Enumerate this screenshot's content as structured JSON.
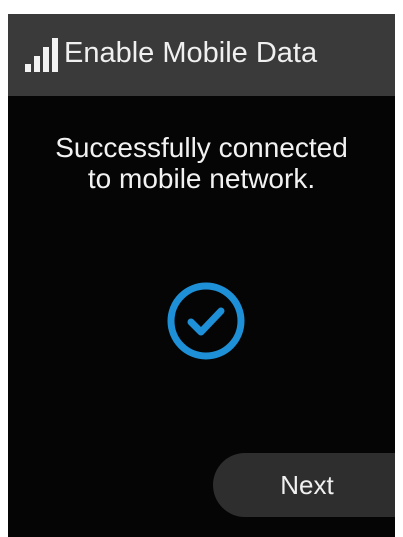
{
  "header": {
    "title": "Enable Mobile Data",
    "icon": "signal-strength-icon"
  },
  "main": {
    "message_line1": "Successfully connected",
    "message_line2": "to mobile network.",
    "status_icon": "check-circle-icon"
  },
  "footer": {
    "next_label": "Next"
  },
  "colors": {
    "background": "#050505",
    "header_background": "#3a3a3a",
    "accent": "#1e90d8",
    "button_background": "#2e2e2e",
    "text": "#f0f0f0"
  }
}
